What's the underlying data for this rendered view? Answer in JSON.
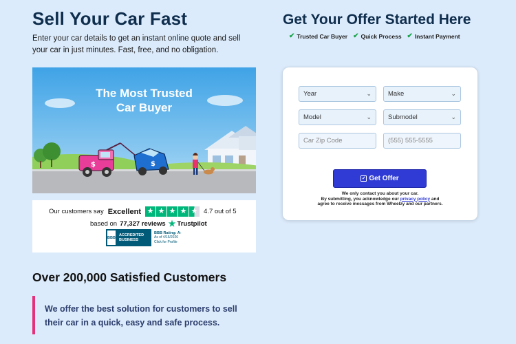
{
  "left": {
    "title": "Sell Your Car Fast",
    "intro": "Enter your car details to get an instant online quote and sell your car in just minutes. Fast, free, and no obligation.",
    "hero_title_line1": "The Most Trusted",
    "hero_title_line2": "Car Buyer",
    "trustpilot": {
      "prefix": "Our customers say",
      "rating_word": "Excellent",
      "score": "4.7 out of 5",
      "based_on": "based on",
      "reviews": "77,327 reviews",
      "brand": "Trustpilot",
      "star_glyph": "★",
      "star_color": "#00b67a"
    },
    "bbb": {
      "mark": "BBB",
      "line1": "ACCREDITED",
      "line2": "BUSINESS",
      "rating": "BBB Rating: A-",
      "as_of": "As of 4/15/2026",
      "click": "Click for Profile"
    },
    "heading2": "Over 200,000 Satisfied Customers",
    "quote": "We offer the best solution for customers to sell their car in a quick, easy and safe process."
  },
  "right": {
    "title": "Get Your Offer Started Here",
    "badges": [
      "Trusted Car Buyer",
      "Quick Process",
      "Instant Payment"
    ],
    "check_glyph": "✔",
    "form": {
      "year": "Year",
      "make": "Make",
      "model": "Model",
      "submodel": "Submodel",
      "zip_placeholder": "Car Zip Code",
      "phone_placeholder": "(555) 555-5555",
      "submit": "Get Offer",
      "fine1": "We only contact you about your car.",
      "fine2a": "By submitting, you acknowledge our",
      "privacy_link": "privacy policy",
      "fine2b": "and",
      "fine3": "agree to receive messages from Wheelzy and our partners."
    },
    "accent_color": "#2f3bd4"
  }
}
